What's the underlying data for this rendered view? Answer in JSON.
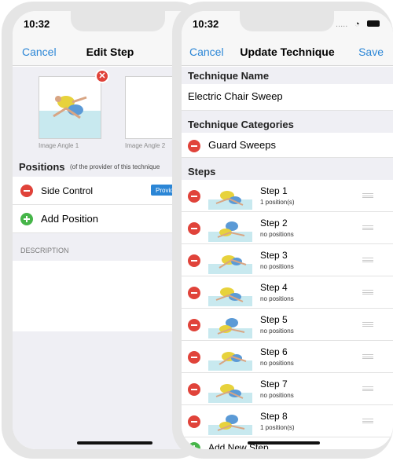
{
  "left_screen": {
    "status": {
      "time": "10:32"
    },
    "nav": {
      "cancel": "Cancel",
      "title": "Edit Step"
    },
    "images": {
      "angle1": "Image Angle 1",
      "angle2": "Image Angle 2"
    },
    "positions": {
      "title": "Positions",
      "note": "(of the provider of this technique",
      "items": [
        {
          "label": "Side Control",
          "badge": "Provid"
        }
      ],
      "add_label": "Add Position"
    },
    "description": {
      "header": "DESCRIPTION"
    }
  },
  "right_screen": {
    "status": {
      "time": "10:32",
      "signal": "....."
    },
    "nav": {
      "cancel": "Cancel",
      "title": "Update Technique",
      "save": "Save"
    },
    "technique_name": {
      "header": "Technique Name",
      "value": "Electric Chair Sweep"
    },
    "categories": {
      "header": "Technique Categories",
      "items": [
        "Guard Sweeps"
      ]
    },
    "steps": {
      "header": "Steps",
      "items": [
        {
          "title": "Step 1",
          "sub": "1 position(s)"
        },
        {
          "title": "Step 2",
          "sub": "no positions"
        },
        {
          "title": "Step 3",
          "sub": "no positions"
        },
        {
          "title": "Step 4",
          "sub": "no positions"
        },
        {
          "title": "Step 5",
          "sub": "no positions"
        },
        {
          "title": "Step 6",
          "sub": "no positions"
        },
        {
          "title": "Step 7",
          "sub": "no positions"
        },
        {
          "title": "Step 8",
          "sub": "1 position(s)"
        }
      ],
      "add_label": "Add New Step"
    }
  },
  "colors": {
    "accent": "#2b86d6",
    "delete": "#e0433a",
    "add": "#46b549",
    "mat": "#c8e9ef",
    "header_bg": "#efeff4"
  }
}
